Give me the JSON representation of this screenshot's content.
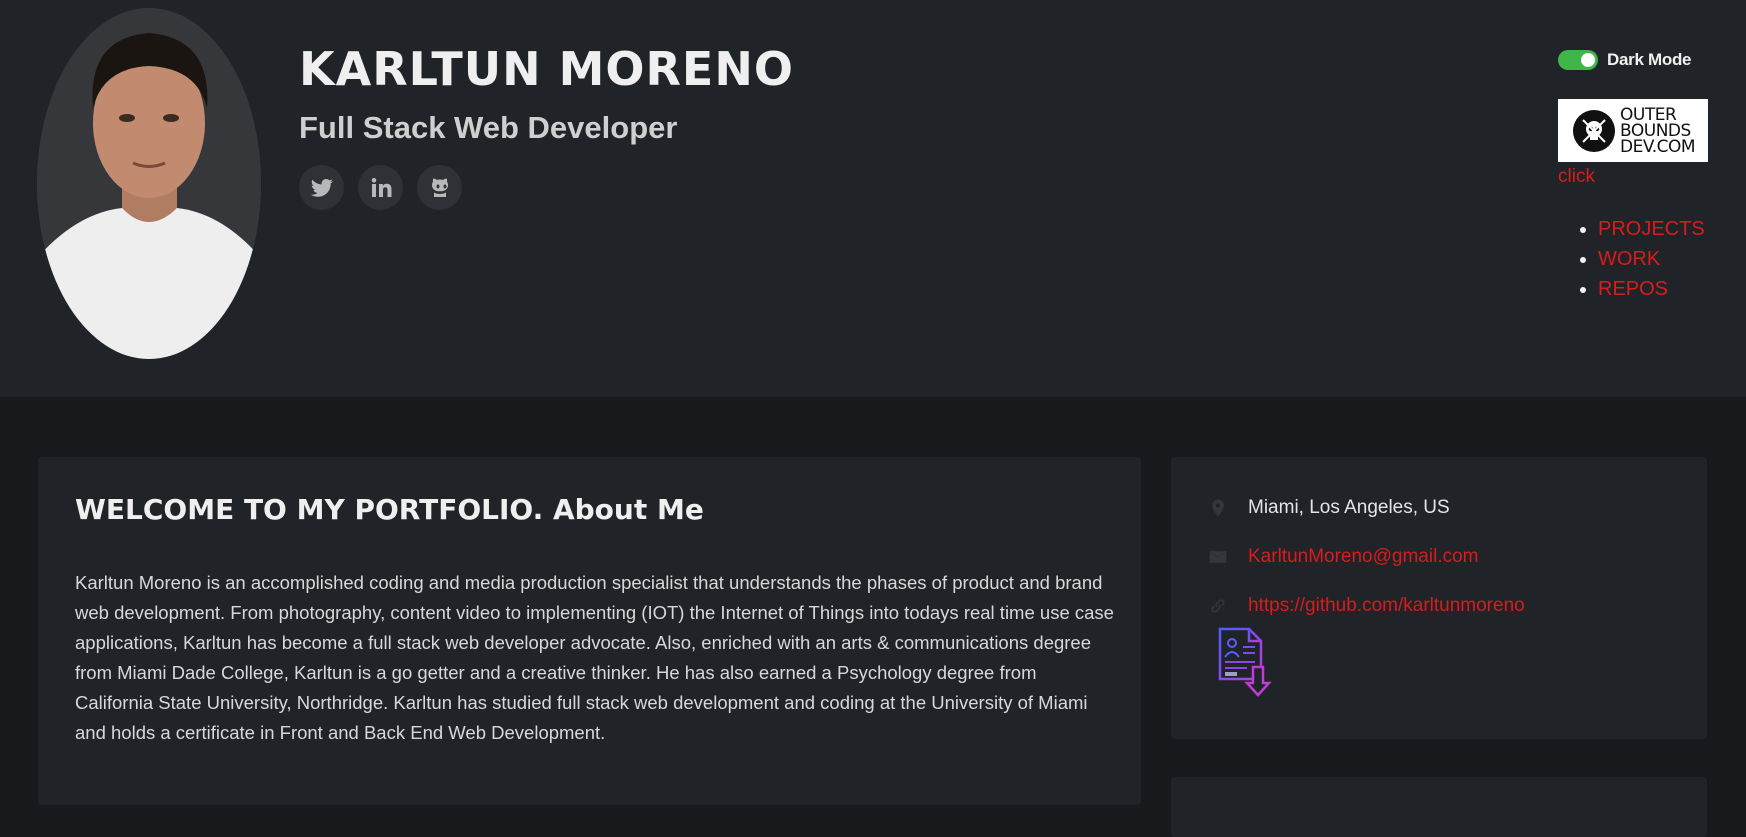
{
  "profile": {
    "name": "KARLTUN MORENO",
    "title": "Full Stack Web Developer",
    "social": [
      {
        "icon": "twitter-icon"
      },
      {
        "icon": "linkedin-icon"
      },
      {
        "icon": "github-icon"
      }
    ]
  },
  "top_right": {
    "dark_mode_label": "Dark Mode",
    "dark_mode_on": true,
    "logo_lines": [
      "OUTER",
      "BOUNDS",
      "DEV.COM"
    ],
    "click_label": "click",
    "nav": [
      "PROJECTS",
      "WORK",
      "REPOS"
    ]
  },
  "about": {
    "heading": "WELCOME TO MY PORTFOLIO. About Me",
    "body": "Karltun Moreno is an accomplished coding and media production specialist that understands the phases of product and brand web development. From photography, content video to implementing (IOT) the Internet of Things into todays real time use case applications, Karltun has become a full stack web developer advocate. Also, enriched with an arts & communications degree from Miami Dade College, Karltun is a go getter and a creative thinker. He has also earned a Psychology degree from California State University, Northridge. Karltun has studied full stack web development and coding at the University of Miami and holds a certificate in Front and Back End Web Development."
  },
  "contact": {
    "location": "Miami, Los Angeles, US",
    "email": "KarltunMoreno@gmail.com",
    "github": "https://github.com/karltunmoreno",
    "resume_icon": "resume-download-icon"
  },
  "colors": {
    "accent": "#d91c1c",
    "toggle": "#3fb54a",
    "header_bg": "#202327",
    "page_bg": "#17191c"
  }
}
